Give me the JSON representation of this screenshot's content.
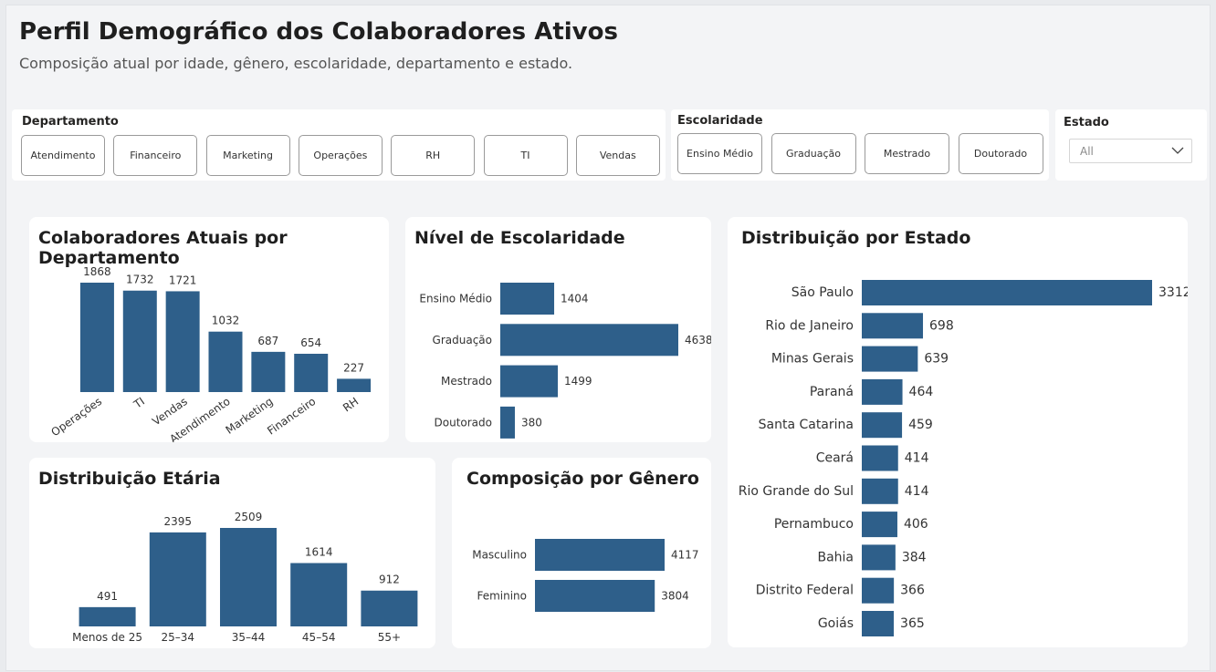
{
  "header": {
    "title": "Perfil Demográfico dos Colaboradores Ativos",
    "subtitle": "Composição atual por idade, gênero, escolaridade, departamento e estado."
  },
  "filters": {
    "departamento": {
      "label": "Departamento",
      "options": [
        "Atendimento",
        "Financeiro",
        "Marketing",
        "Operações",
        "RH",
        "TI",
        "Vendas"
      ]
    },
    "escolaridade": {
      "label": "Escolaridade",
      "options": [
        "Ensino Médio",
        "Graduação",
        "Mestrado",
        "Doutorado"
      ]
    },
    "estado": {
      "label": "Estado",
      "selected": "All"
    }
  },
  "colors": {
    "bar": "#2e5f8a",
    "card": "#ffffff",
    "background": "#f3f4f6"
  },
  "chart_data": [
    {
      "id": "departamento",
      "type": "bar",
      "title": "Colaboradores Atuais por Departamento",
      "categories": [
        "Operações",
        "TI",
        "Vendas",
        "Atendimento",
        "Marketing",
        "Financeiro",
        "RH"
      ],
      "values": [
        1868,
        1732,
        1721,
        1032,
        687,
        654,
        227
      ],
      "orientation": "vertical"
    },
    {
      "id": "escolaridade",
      "type": "bar",
      "title": "Nível de Escolaridade",
      "categories": [
        "Ensino Médio",
        "Graduação",
        "Mestrado",
        "Doutorado"
      ],
      "values": [
        1404,
        4638,
        1499,
        380
      ],
      "orientation": "horizontal"
    },
    {
      "id": "estado",
      "type": "bar",
      "title": "Distribuição por Estado",
      "categories": [
        "São Paulo",
        "Rio de Janeiro",
        "Minas Gerais",
        "Paraná",
        "Santa Catarina",
        "Ceará",
        "Rio Grande do Sul",
        "Pernambuco",
        "Bahia",
        "Distrito Federal",
        "Goiás"
      ],
      "values": [
        3312,
        698,
        639,
        464,
        459,
        414,
        414,
        406,
        384,
        366,
        365
      ],
      "orientation": "horizontal"
    },
    {
      "id": "etaria",
      "type": "bar",
      "title": "Distribuição Etária",
      "categories": [
        "Menos de 25",
        "25–34",
        "35–44",
        "45–54",
        "55+"
      ],
      "values": [
        491,
        2395,
        2509,
        1614,
        912
      ],
      "orientation": "vertical"
    },
    {
      "id": "genero",
      "type": "bar",
      "title": "Composição por Gênero",
      "categories": [
        "Masculino",
        "Feminino"
      ],
      "values": [
        4117,
        3804
      ],
      "orientation": "horizontal"
    }
  ]
}
